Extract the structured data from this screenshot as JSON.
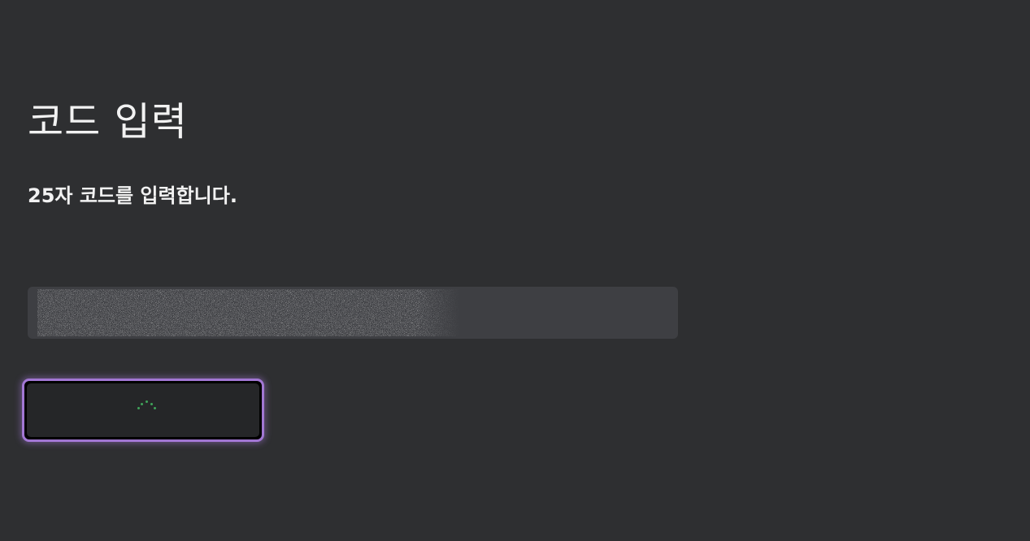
{
  "page": {
    "title": "코드 입력",
    "subtitle": "25자 코드를 입력합니다."
  },
  "code_field": {
    "value_obscured": true
  },
  "redeem_button": {
    "state": "loading",
    "spinner_icon": "loading-spinner-icon"
  },
  "colors": {
    "background": "#2e2f31",
    "text": "#f2f2f2",
    "field": "#3e3f43",
    "focus_ring": "#a277d4",
    "spinner": "#3fa35a"
  }
}
